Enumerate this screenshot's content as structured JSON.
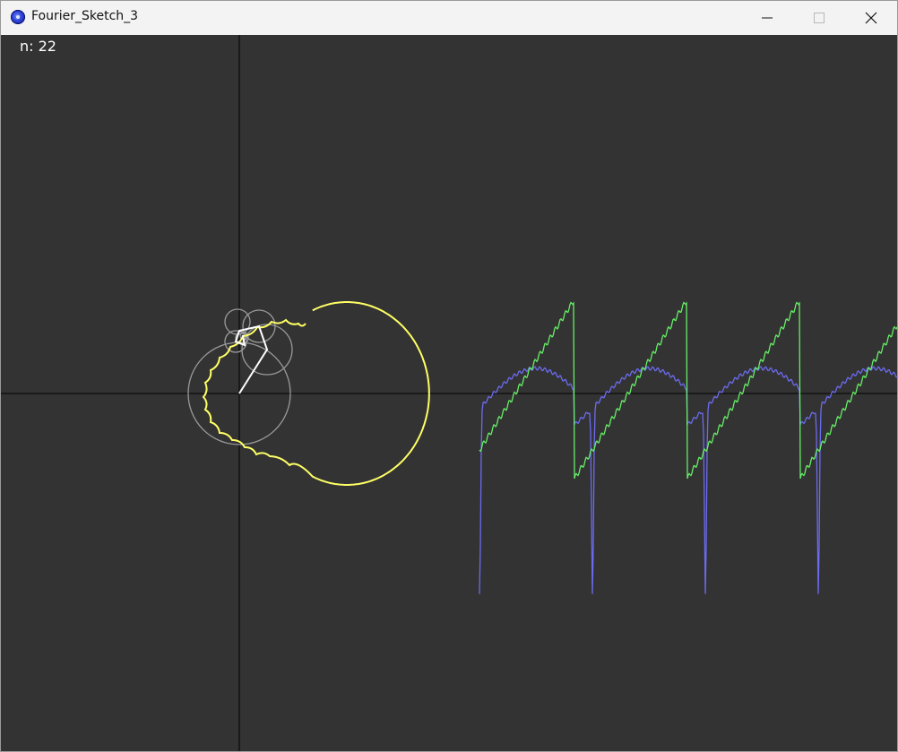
{
  "window": {
    "title": "Fourier_Sketch_3",
    "icon": "processing-app-icon",
    "controls": [
      "minimize-icon",
      "maximize-icon",
      "close-icon"
    ]
  },
  "sketch": {
    "n_label": "n: 22",
    "n_terms": 22,
    "colors": {
      "background": "#333333",
      "axes": "#000000",
      "epicycle_circles": "#9a9a9a",
      "radius_lines": "#ffffff",
      "traced_path": "#ffff66",
      "wave_green": "#66ee66",
      "wave_blue": "#6b6bf0"
    },
    "series": [
      {
        "color": "green",
        "shape": "sawtooth",
        "periods_visible": 4
      },
      {
        "color": "blue",
        "shape": "rounded peaks with sharp downward spikes",
        "periods_visible": 4
      }
    ]
  }
}
